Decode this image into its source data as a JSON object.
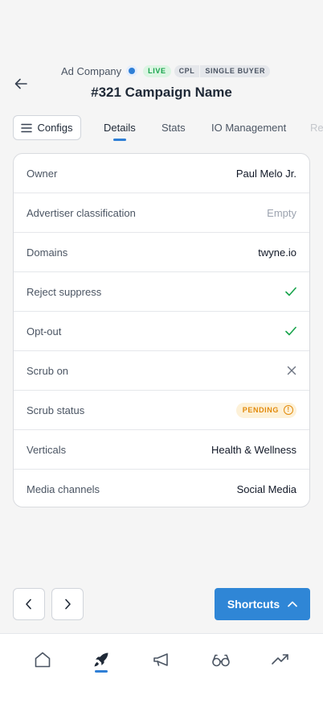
{
  "header": {
    "company": "Ad Company",
    "badge_live": "LIVE",
    "badge_cpl": "CPL",
    "badge_buyer": "SINGLE BUYER",
    "title": "#321 Campaign Name"
  },
  "tabs": {
    "configs_label": "Configs",
    "items": [
      "Details",
      "Stats",
      "IO Management",
      "Re"
    ],
    "active": "Details"
  },
  "details": {
    "rows": [
      {
        "label": "Owner",
        "value": "Paul Melo Jr."
      },
      {
        "label": "Advertiser classification",
        "value": "Empty"
      },
      {
        "label": "Domains",
        "value": "twyne.io"
      },
      {
        "label": "Reject suppress",
        "value": "check-icon"
      },
      {
        "label": "Opt-out",
        "value": "check-icon"
      },
      {
        "label": "Scrub on",
        "value": "x-icon"
      },
      {
        "label": "Scrub status",
        "value": "PENDING"
      },
      {
        "label": "Verticals",
        "value": "Health & Wellness"
      },
      {
        "label": "Media channels",
        "value": "Social Media"
      }
    ]
  },
  "footer": {
    "shortcuts_label": "Shortcuts"
  },
  "bottom_nav": {
    "items": [
      "home-icon",
      "rocket-icon",
      "megaphone-icon",
      "glasses-icon",
      "trending-up-icon"
    ],
    "active": "rocket-icon"
  },
  "colors": {
    "accent": "#2f86d6",
    "live": "#16a34a",
    "pending": "#e28a0b",
    "check": "#16a34a"
  }
}
